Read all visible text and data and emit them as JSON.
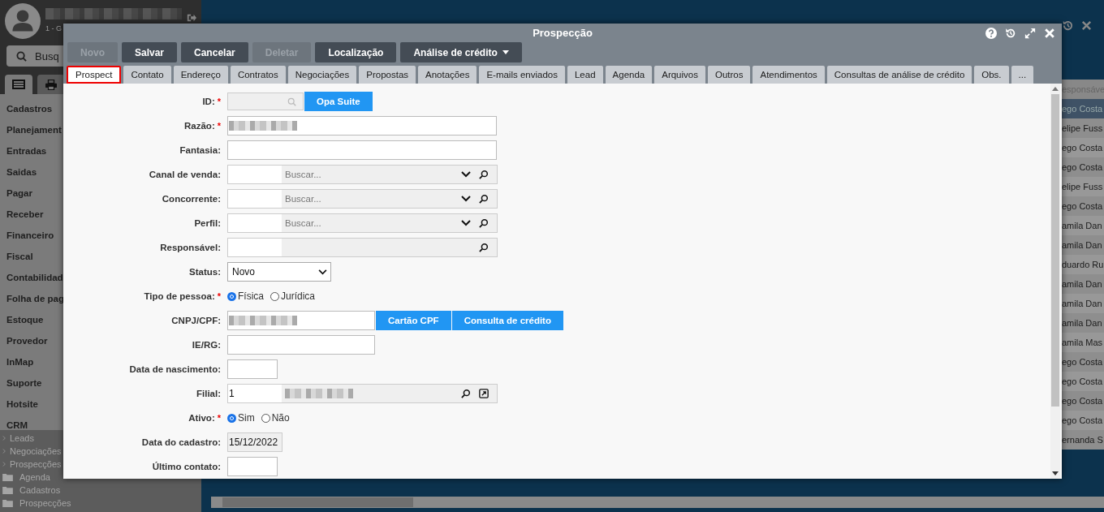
{
  "sidebar": {
    "user_line": "1 - G",
    "search": {
      "placeholder": "Busq"
    },
    "tabs": [
      {
        "kind": "list",
        "selected": true
      },
      {
        "kind": "print",
        "selected": false
      }
    ],
    "menu": [
      "Cadastros",
      "Planejament",
      "Entradas",
      "Saidas",
      "Pagar",
      "Receber",
      "Financeiro",
      "Fiscal",
      "Contabilidad",
      "Folha de pag",
      "Estoque",
      "Provedor",
      "InMap",
      "Suporte",
      "Hotsite",
      "CRM"
    ],
    "tree": [
      {
        "kind": "branch",
        "label": "Leads"
      },
      {
        "kind": "branch",
        "label": "Negociações"
      },
      {
        "kind": "branch",
        "label": "Prospecções"
      },
      {
        "kind": "folder",
        "label": "Agenda"
      },
      {
        "kind": "folder",
        "label": "Cadastros"
      },
      {
        "kind": "folder",
        "label": "Prospecções"
      }
    ]
  },
  "background_table": {
    "column_heading": "esponsáve",
    "rows": [
      {
        "text": "ego Costa",
        "selected": true
      },
      {
        "text": "elipe Fuss",
        "selected": false
      },
      {
        "text": "ego Costa",
        "selected": false
      },
      {
        "text": "ego Costa",
        "selected": false
      },
      {
        "text": "elipe Fuss",
        "selected": false
      },
      {
        "text": "ego Costa",
        "selected": false
      },
      {
        "text": "amila Dan",
        "selected": false
      },
      {
        "text": "amila Dan",
        "selected": false
      },
      {
        "text": "duardo Ru",
        "selected": false
      },
      {
        "text": "amila Dan",
        "selected": false
      },
      {
        "text": "amila Dan",
        "selected": false
      },
      {
        "text": "amila Dan",
        "selected": false
      },
      {
        "text": "amila Mas",
        "selected": false
      },
      {
        "text": "ego Costa",
        "selected": false
      },
      {
        "text": "ego Costa",
        "selected": false
      },
      {
        "text": "ego Costa",
        "selected": false
      },
      {
        "text": "ego Costa",
        "selected": false
      },
      {
        "text": "ernanda S",
        "selected": false
      }
    ]
  },
  "window": {
    "title": "Prospecção",
    "toolbar": [
      {
        "label": "Novo",
        "disabled": true,
        "menu": false
      },
      {
        "label": "Salvar",
        "disabled": false,
        "menu": false
      },
      {
        "label": "Cancelar",
        "disabled": false,
        "menu": false
      },
      {
        "label": "Deletar",
        "disabled": true,
        "menu": false
      },
      {
        "label": "Localização",
        "disabled": false,
        "menu": false
      },
      {
        "label": "Análise de crédito",
        "disabled": false,
        "menu": true
      }
    ],
    "tabs": [
      {
        "label": "Prospect",
        "selected": true
      },
      {
        "label": "Contato",
        "selected": false
      },
      {
        "label": "Endereço",
        "selected": false
      },
      {
        "label": "Contratos",
        "selected": false
      },
      {
        "label": "Negociações",
        "selected": false
      },
      {
        "label": "Propostas",
        "selected": false
      },
      {
        "label": "Anotações",
        "selected": false
      },
      {
        "label": "E-mails enviados",
        "selected": false
      },
      {
        "label": "Lead",
        "selected": false
      },
      {
        "label": "Agenda",
        "selected": false
      },
      {
        "label": "Arquivos",
        "selected": false
      },
      {
        "label": "Outros",
        "selected": false
      },
      {
        "label": "Atendimentos",
        "selected": false
      },
      {
        "label": "Consultas de análise de crédito",
        "selected": false
      },
      {
        "label": "Obs.",
        "selected": false
      },
      {
        "label": "...",
        "selected": false
      }
    ],
    "required_mark": "*",
    "fields": [
      {
        "label": "ID:",
        "required": true,
        "kind": "id-lookup",
        "button": "Opa Suite"
      },
      {
        "label": "Razão:",
        "required": true,
        "kind": "text",
        "redacted": true
      },
      {
        "label": "Fantasia:",
        "required": false,
        "kind": "text",
        "redacted": false
      },
      {
        "label": "Canal de venda:",
        "required": false,
        "kind": "search-select",
        "placeholder": "Buscar..."
      },
      {
        "label": "Concorrente:",
        "required": false,
        "kind": "search-select",
        "placeholder": "Buscar..."
      },
      {
        "label": "Perfil:",
        "required": false,
        "kind": "search-select",
        "placeholder": "Buscar..."
      },
      {
        "label": "Responsável:",
        "required": false,
        "kind": "search"
      },
      {
        "label": "Status:",
        "required": false,
        "kind": "select",
        "value": "Novo"
      },
      {
        "label": "Tipo de pessoa:",
        "required": true,
        "kind": "radio",
        "options": [
          {
            "label": "Física",
            "selected": true
          },
          {
            "label": "Jurídica",
            "selected": false
          }
        ]
      },
      {
        "label": "CNPJ/CPF:",
        "required": false,
        "kind": "short-text",
        "redacted": true,
        "buttons": [
          "Cartão CPF",
          "Consulta de crédito"
        ]
      },
      {
        "label": "IE/RG:",
        "required": false,
        "kind": "short-text",
        "redacted": false
      },
      {
        "label": "Data de nascimento:",
        "required": false,
        "kind": "date"
      },
      {
        "label": "Filial:",
        "required": false,
        "kind": "lookup-link",
        "value": "1",
        "redacted": true
      },
      {
        "label": "Ativo:",
        "required": true,
        "kind": "radio",
        "options": [
          {
            "label": "Sim",
            "selected": true
          },
          {
            "label": "Não",
            "selected": false
          }
        ]
      },
      {
        "label": "Data do cadastro:",
        "required": false,
        "kind": "readonly",
        "value": "15/12/2022"
      },
      {
        "label": "Último contato:",
        "required": false,
        "kind": "date"
      }
    ]
  }
}
